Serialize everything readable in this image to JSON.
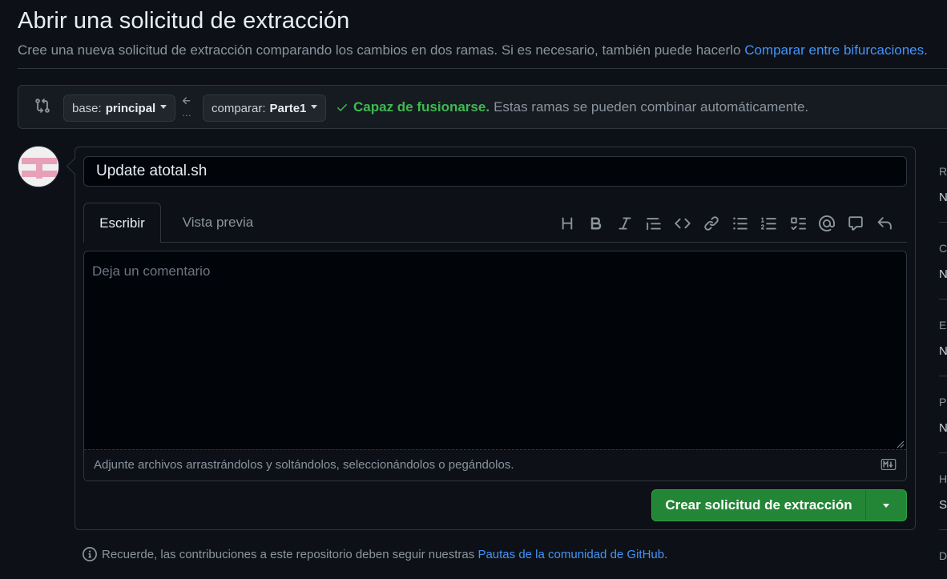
{
  "page": {
    "title": "Abrir una solicitud de extracción",
    "subtitle": "Cree una nueva solicitud de extracción comparando los cambios en dos ramas. Si es necesario, también puede hacerlo",
    "subtitle_link": "Comparar entre bifurcaciones",
    "subtitle_end": "."
  },
  "range": {
    "base_label": "base:",
    "base_value": "principal",
    "compare_label": "comparar:",
    "compare_value": "Parte1",
    "status_ok": "Capaz de fusionarse.",
    "status_desc": "Estas ramas se pueden combinar automáticamente."
  },
  "form": {
    "title_value": "Update atotal.sh",
    "tabs": [
      "Escribir",
      "Vista previa"
    ],
    "comment_placeholder": "Deja un comentario",
    "attach_text": "Adjunte archivos arrastrándolos y soltándolos, seleccionándolos o pegándolos.",
    "toolbar": [
      "heading-icon",
      "bold-icon",
      "italic-icon",
      "quote-icon",
      "code-icon",
      "link-icon",
      "unordered-list-icon",
      "ordered-list-icon",
      "task-list-icon",
      "mention-icon",
      "reference-icon",
      "reply-icon"
    ],
    "create_button": "Crear solicitud de extracción"
  },
  "note": {
    "text": "Recuerde, las contribuciones a este repositorio deben seguir nuestras",
    "link": "Pautas de la comunidad de GitHub",
    "end": "."
  },
  "sidebar": {
    "letters": [
      "R",
      "N",
      "C",
      "N",
      "E",
      "N",
      "P",
      "N",
      "H",
      "Si",
      "D"
    ]
  },
  "colors": {
    "background": "#0d1117",
    "accent_green": "#238636",
    "link_blue": "#4493f8",
    "success_green": "#3fb950"
  }
}
